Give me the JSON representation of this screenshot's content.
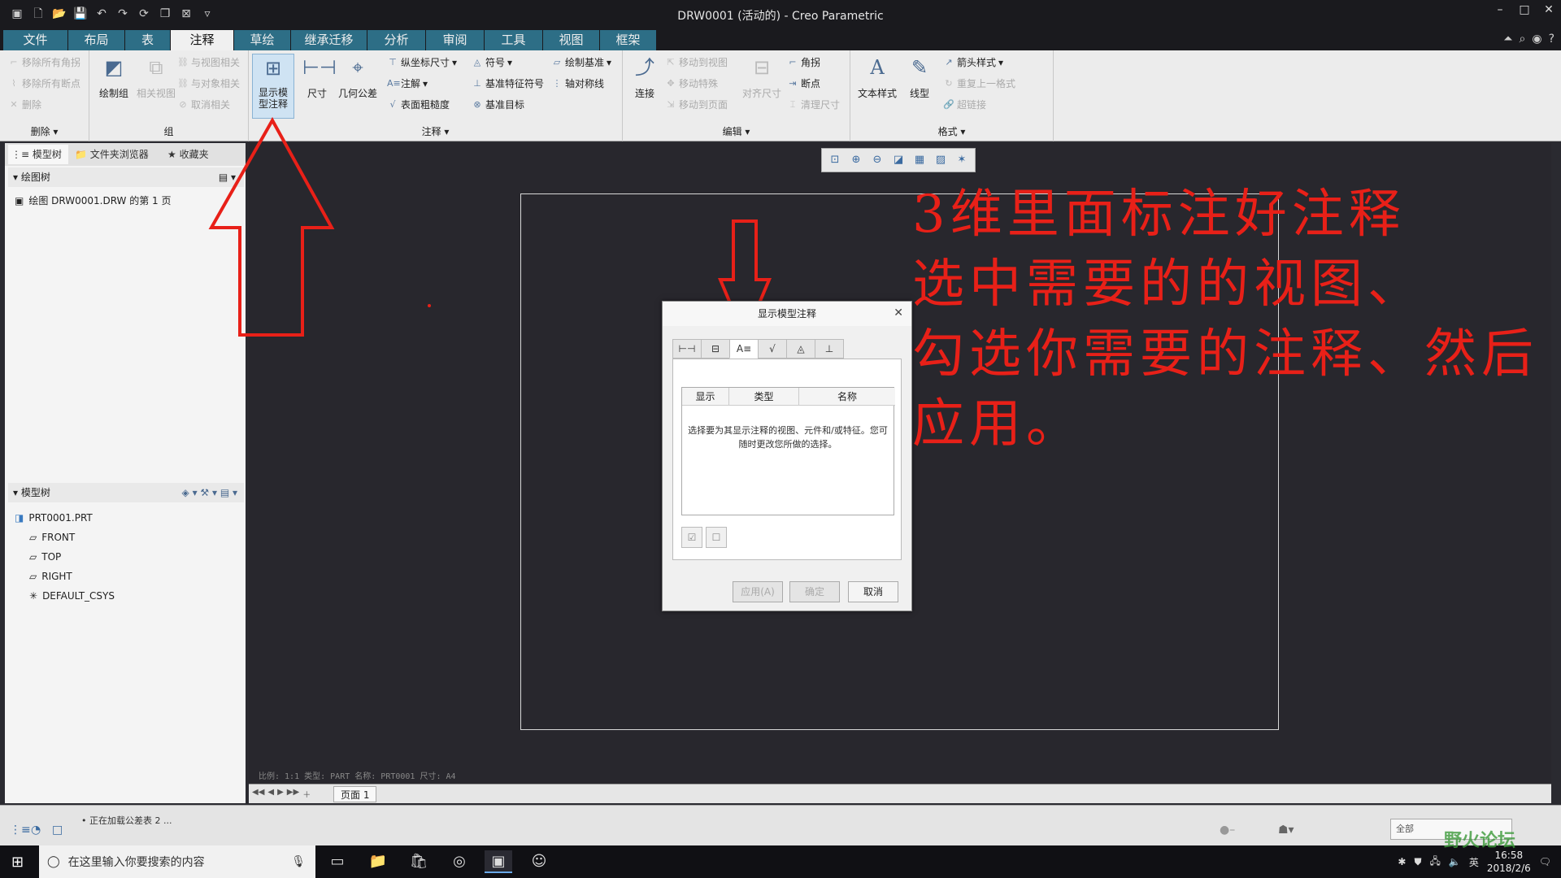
{
  "window": {
    "title": "DRW0001 (活动的) - Creo Parametric"
  },
  "tabs": [
    "文件",
    "布局",
    "表",
    "注释",
    "草绘",
    "继承迁移",
    "分析",
    "审阅",
    "工具",
    "视图",
    "框架"
  ],
  "active_tab": "注释",
  "ribbon": {
    "delete_group": {
      "items": [
        "移除所有角拐",
        "移除所有断点",
        "删除"
      ],
      "label": "删除"
    },
    "group_group": {
      "items": [
        "绘制组",
        "相关视图",
        "与视图相关",
        "与对象相关",
        "取消相关"
      ],
      "label": "组"
    },
    "annot_group": {
      "show_model": "显示模型注释",
      "dimension": "尺寸",
      "gtol": "几何公差",
      "ordinate": "纵坐标尺寸",
      "note": "注解",
      "surface_finish": "表面粗糙度",
      "symbol": "符号",
      "datum_feature": "基准特征符号",
      "datum_target": "基准目标",
      "draw_datum": "绘制基准",
      "axis_sym": "轴对称线",
      "label": "注释"
    },
    "edit_group": {
      "connect": "连接",
      "move_view": "移动到视图",
      "move_special": "移动特殊",
      "move_page": "移动到页面",
      "align": "对齐尺寸",
      "corner": "角拐",
      "breakpoint": "断点",
      "clean": "清理尺寸",
      "label": "编辑"
    },
    "format_group": {
      "text_style": "文本样式",
      "line_style": "线型",
      "arrow_style": "箭头样式",
      "repeat_last": "重复上一格式",
      "hyperlink": "超链接",
      "label": "格式"
    }
  },
  "left_panel": {
    "tabs": [
      "模型树",
      "文件夹浏览器",
      "收藏夹"
    ],
    "drawing_tree_header": "绘图树",
    "drawing_tree_items": [
      "绘图 DRW0001.DRW 的第 1 页"
    ],
    "model_tree_header": "模型树",
    "model_tree_items": [
      "PRT0001.PRT",
      "FRONT",
      "TOP",
      "RIGHT",
      "DEFAULT_CSYS"
    ]
  },
  "canvas": {
    "sheet_info": "比例: 1:1    类型: PART    名称: PRT0001    尺寸: A4",
    "page_tab": "页面 1"
  },
  "dialog": {
    "title": "显示模型注释",
    "columns": [
      "显示",
      "类型",
      "名称"
    ],
    "message": "选择要为其显示注释的视图、元件和/或特征。您可随时更改您所做的选择。",
    "buttons": {
      "apply": "应用(A)",
      "ok": "确定",
      "cancel": "取消"
    }
  },
  "annotation": {
    "lines": [
      "3维里面标注好注释",
      "选中需要的的视图、",
      "勾选你需要的注释、然后",
      "应用。"
    ],
    "color": "#e82018"
  },
  "status": {
    "message": "• 正在加载公差表 2 ...",
    "filter": "全部"
  },
  "taskbar": {
    "search_placeholder": "在这里输入你要搜索的内容",
    "ime": "英",
    "time": "16:58",
    "date": "2018/2/6"
  },
  "watermark": "野火论坛"
}
